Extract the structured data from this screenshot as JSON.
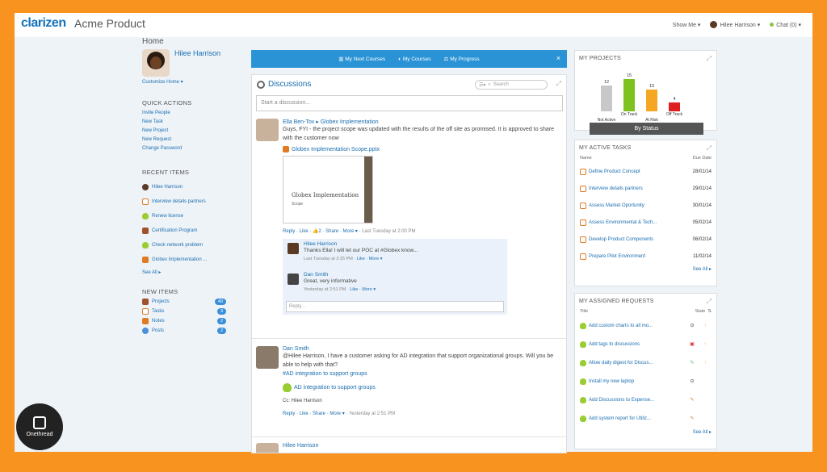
{
  "app": {
    "logo": "clarizen",
    "product": "Acme Product"
  },
  "topbar": {
    "show_me": "Show Me ▾",
    "user": "Hilee Harrison ▾",
    "chat": "Chat (0) ▾"
  },
  "left": {
    "page_title": "Home",
    "profile_name": "Hilee Harrison",
    "customize": "Customize Home ▾",
    "quick_actions_title": "QUICK ACTIONS",
    "quick_actions": [
      "Invite People",
      "New Task",
      "New Project",
      "New Request",
      "Change Password"
    ],
    "recent_title": "RECENT ITEMS",
    "recent": [
      {
        "icon": "person-icon",
        "label": "Hilee Harrison"
      },
      {
        "icon": "task-icon",
        "label": "Interview details partners"
      },
      {
        "icon": "bulb-icon",
        "label": "Renew license"
      },
      {
        "icon": "briefcase-icon",
        "label": "Certification Program"
      },
      {
        "icon": "bulb-icon",
        "label": "Check network problem"
      },
      {
        "icon": "document-icon",
        "label": "Globex Implementation ..."
      }
    ],
    "see_all": "See All ▸",
    "new_items_title": "NEW ITEMS",
    "new_items": [
      {
        "label": "Projects",
        "count": "40"
      },
      {
        "label": "Tasks",
        "count": "3"
      },
      {
        "label": "Notes",
        "count": "2"
      },
      {
        "label": "Posts",
        "count": "2"
      }
    ]
  },
  "bluebar": {
    "next": "My Next Courses",
    "courses": "My Courses",
    "progress": "My Progress",
    "close": "×"
  },
  "discussions": {
    "title": "Discussions",
    "search_placeholder": "Search",
    "start_placeholder": "Start a discussion...",
    "post1": {
      "author": "Ella Ben-Tov ▸ Globex Implementation",
      "text": "Guys, FYI - the project scope was updated with the results of the off site as promised. It is approved to share with the customer now",
      "attachment": "Globex Implementation Scope.pptx",
      "slide_title": "Globex Implementation",
      "slide_sub": "Scope",
      "actions": "Reply · Like · 👍2 · Share · More ▾ · ",
      "time": "Last Tuesday at 2:00 PM",
      "replies": [
        {
          "name": "Hilee Harrison",
          "text": "Thanks Ella! I will let our POC at #Globex know...",
          "meta": "Last Tuesday at 2:25 PM · ",
          "links": "Like · More ▾"
        },
        {
          "name": "Dan Smith",
          "text": "Great, very informative",
          "meta": "Yesterday at 2:51 PM · ",
          "links": "Like · More ▾"
        }
      ],
      "reply_placeholder": "Reply..."
    },
    "post2": {
      "author": "Dan Smith",
      "text": "@Hilee Harrison, I have a customer asking for AD integration that support organizational groups. Will you be able to help with that?",
      "hashtag": "#AD integration to support groups",
      "attachment": "AD integration to support groups",
      "cc": "Cc: Hilee Harrison",
      "actions": "Reply · Like · Share · More ▾ · ",
      "time": "Yesterday at 2:51 PM"
    },
    "post3": {
      "author": "Hilee Harrison"
    }
  },
  "my_projects": {
    "title": "MY PROJECTS",
    "footer": "By Status",
    "chart_data": {
      "type": "bar",
      "categories": [
        "Not Active",
        "On Track",
        "At Risk",
        "Off Track"
      ],
      "values": [
        12,
        15,
        10,
        4
      ],
      "colors": [
        "#c8c8c8",
        "#7dc21e",
        "#f5a623",
        "#e02020"
      ]
    }
  },
  "active_tasks": {
    "title": "MY ACTIVE TASKS",
    "col_name": "Name",
    "col_due": "Due Date",
    "rows": [
      {
        "name": "Define Product Concept",
        "due": "28/01/14"
      },
      {
        "name": "Interview details partners",
        "due": "29/01/14"
      },
      {
        "name": "Assess Market Oportunity",
        "due": "30/01/14"
      },
      {
        "name": "Assess Environmental & Tech...",
        "due": "05/02/14"
      },
      {
        "name": "Develop Product Components",
        "due": "06/02/14"
      },
      {
        "name": "Prepare Pilot Environment",
        "due": "11/02/14"
      }
    ],
    "see_all": "See All ▸"
  },
  "assigned_requests": {
    "title": "MY ASSIGNED REQUESTS",
    "col_title": "Title",
    "col_state": "State",
    "rows": [
      {
        "name": "Add custom charts to all mo...",
        "state": "⊙",
        "prio": "↑"
      },
      {
        "name": "Add tags to discussions",
        "state": "▣",
        "prio": "↑"
      },
      {
        "name": "Allow daily digest for Discus...",
        "state": "✎",
        "prio": "↑"
      },
      {
        "name": "Install my new laptop",
        "state": "⊙",
        "prio": ""
      },
      {
        "name": "Add Discussions to Expense...",
        "state": "✎",
        "prio": ""
      },
      {
        "name": "Add system report for Utiliz...",
        "state": "✎",
        "prio": ""
      }
    ],
    "see_all": "See All ▸"
  },
  "watermark": {
    "label": "Onethread"
  }
}
